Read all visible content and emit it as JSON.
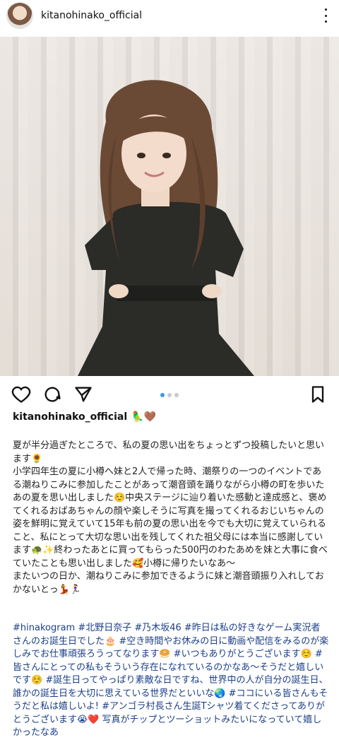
{
  "header": {
    "username": "kitanohinako_official",
    "more_icon": "more-vertical-icon"
  },
  "post": {
    "photo_alt": "",
    "carousel": {
      "count": 3,
      "active_index": 0
    }
  },
  "actions": {
    "like_icon": "heart-icon",
    "comment_icon": "comment-icon",
    "share_icon": "share-icon",
    "save_icon": "bookmark-icon"
  },
  "caption": {
    "owner": "kitanohinako_official",
    "owner_emoji": "🦜🤎",
    "body": "夏が半分過ぎたところで、私の夏の思い出をちょっとずつ投稿したいと思います🌻\n小学四年生の夏に小樽へ妹と2人で帰った時、潮祭りの一つのイベントである潮ねりこみに参加したことがあって潮音頭を踊りながら小樽の町を歩いたあの夏を思い出しました☺️中央ステージに辿り着いた感動と達成感と、褒めてくれるおばあちゃんの顔や楽しそうに写真を撮ってくれるおじいちゃんの姿を鮮明に覚えていて15年も前の夏の思い出を今でも大切に覚えていられること、私にとって大切な思い出を残してくれた祖父母には本当に感謝しています🐢✨終わったあとに買ってもらった500円のわたあめを妹と大事に食べていたことも思い出しました🥰小樽に帰りたいなあ〜\nまたいつの日か、潮ねりこみに参加できるように妹と潮音頭振り入れしておかないとっ💃🏃‍♀️",
    "tags": "#hinakogram #北野日奈子 #乃木坂46 #昨日は私の好きなゲーム実況者さんのお誕生日でした🎂 #空き時間やお休みの日に動画や配信をみるのが楽しみでお仕事頑張ろうってなります🥯 #いつもありがとうございます☺️ #皆さんにとっての私もそういう存在になれているのかなあ〜そうだと嬉しいです☺️ #誕生日ってやっぱり素敵な日ですね、世界中の人が自分の誕生日、誰かの誕生日を大切に思えている世界だといいな🌏 #ココにいる皆さんもそうだと私は嬉しいよ! #アンゴラ村長さん生誕Tシャツ着てくださってありがとうございます😭❤️ 写真がチップとツーショットみたいになっていて嬉しかったなあ"
  },
  "colors": {
    "accent": "#3897f0",
    "hashtag": "#1b3f88"
  }
}
